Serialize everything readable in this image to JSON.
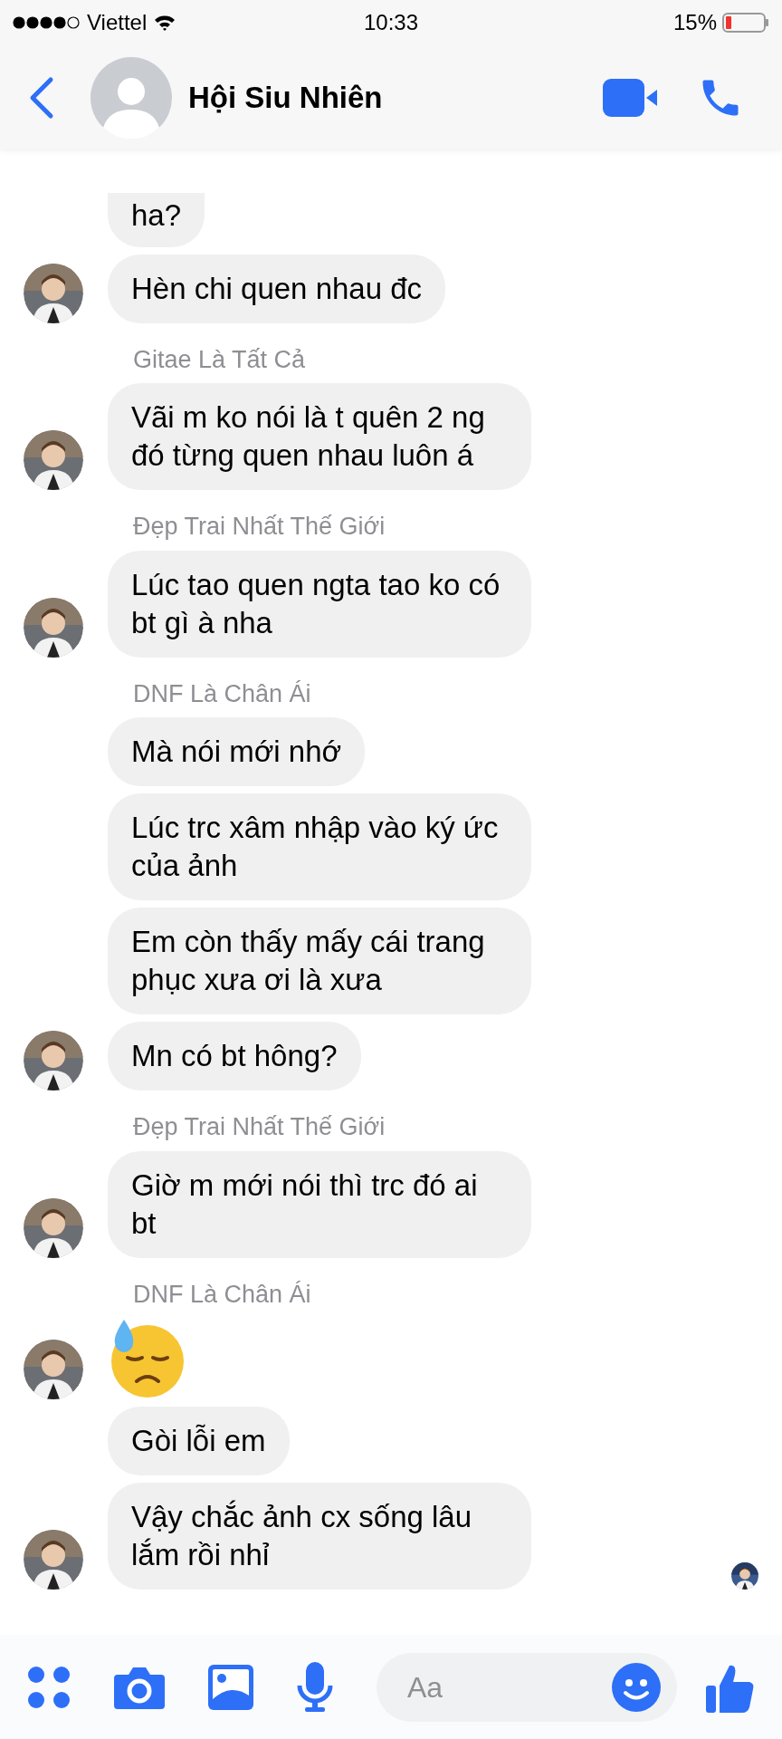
{
  "status_bar": {
    "carrier": "Viettel",
    "time": "10:33",
    "battery": "15%"
  },
  "header": {
    "title": "Hội Siu Nhiên"
  },
  "messages": [
    {
      "kind": "text",
      "text": "ha?",
      "avatar": false,
      "cut": true
    },
    {
      "kind": "text",
      "text": "Hèn chi quen nhau đc",
      "avatar": true
    },
    {
      "kind": "text",
      "sender": "Gitae Là Tất Cả",
      "text": "Vãi m ko nói là t quên 2 ng đó từng quen nhau luôn á",
      "avatar": true
    },
    {
      "kind": "text",
      "sender": "Đẹp Trai Nhất Thế Giới",
      "text": "Lúc tao quen ngta tao ko có bt gì à nha",
      "avatar": true
    },
    {
      "kind": "text",
      "sender": "DNF Là Chân Ái",
      "text": "Mà nói mới nhớ",
      "avatar": false
    },
    {
      "kind": "text",
      "text": "Lúc trc xâm nhập vào ký ức của ảnh",
      "avatar": false
    },
    {
      "kind": "text",
      "text": "Em còn thấy mấy cái trang phục xưa ơi là xưa",
      "avatar": false
    },
    {
      "kind": "text",
      "text": "Mn có bt hông?",
      "avatar": true
    },
    {
      "kind": "text",
      "sender": "Đẹp Trai Nhất Thế Giới",
      "text": "Giờ m mới nói thì trc đó ai bt",
      "avatar": true
    },
    {
      "kind": "emoji",
      "sender": "DNF Là Chân Ái",
      "avatar": true
    },
    {
      "kind": "text",
      "text": "Gòi lỗi em",
      "avatar": false
    },
    {
      "kind": "text",
      "text": "Vậy chắc ảnh cx sống lâu lắm rồi nhỉ",
      "avatar": true,
      "seen": true
    }
  ],
  "composer": {
    "placeholder": "Aa"
  }
}
